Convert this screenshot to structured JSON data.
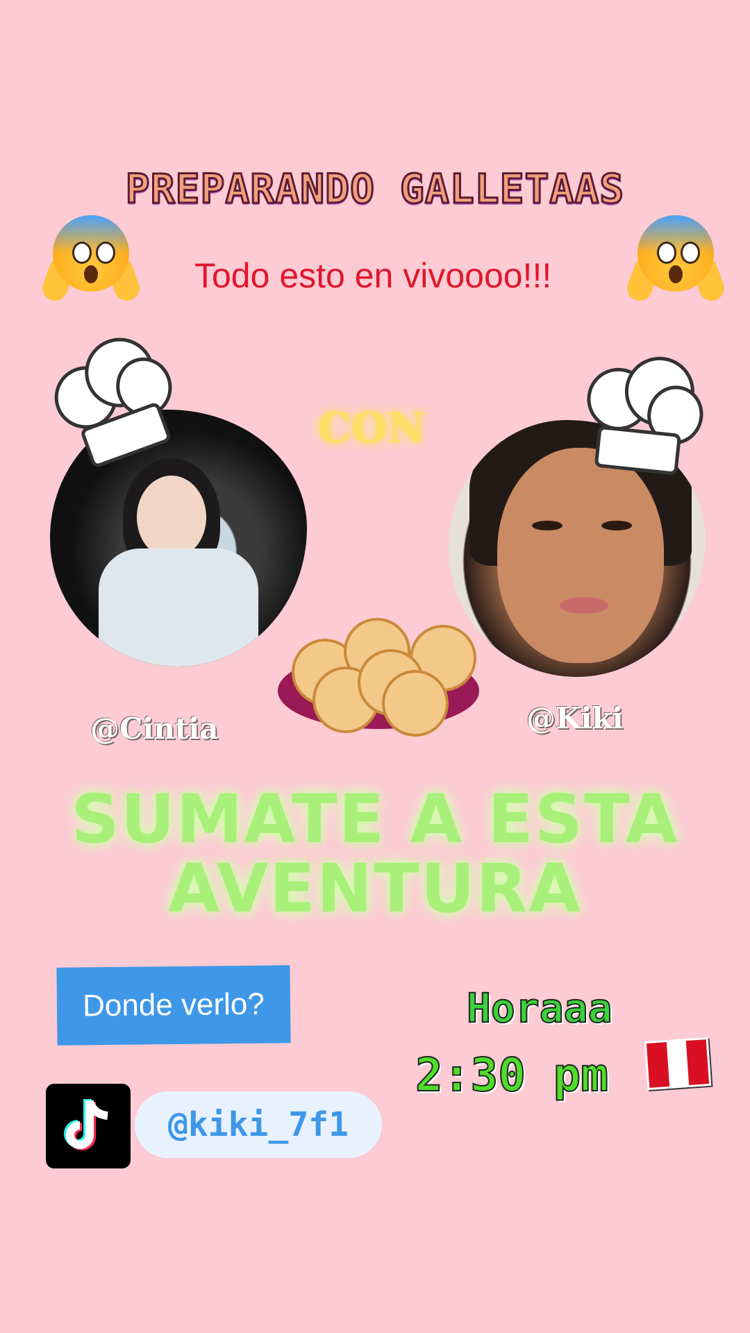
{
  "title": "PREPARANDO GALLETAAS",
  "subtitle": "Todo esto en vivoooo!!!",
  "connector": "CON",
  "hosts": {
    "left": "@Cintia",
    "right": "@Kiki"
  },
  "cta": {
    "line1": "SUMATE A ESTA",
    "line2": "AVENTURA"
  },
  "where_label": "Donde verlo?",
  "tiktok_handle": "@kiki_7f1",
  "schedule": {
    "label": "Horaaa",
    "time": "2:30 pm"
  },
  "icons": {
    "emoji_left": "scared-face-icon",
    "emoji_right": "scared-face-icon",
    "flag": "peru-flag-icon",
    "app": "tiktok-icon",
    "hat": "chef-hat-icon",
    "cookies": "cookies-plate-icon"
  },
  "colors": {
    "background": "#fccbd3",
    "subtitle": "#e0162b",
    "cta": "#a9f07a",
    "button": "#3f97e8"
  }
}
